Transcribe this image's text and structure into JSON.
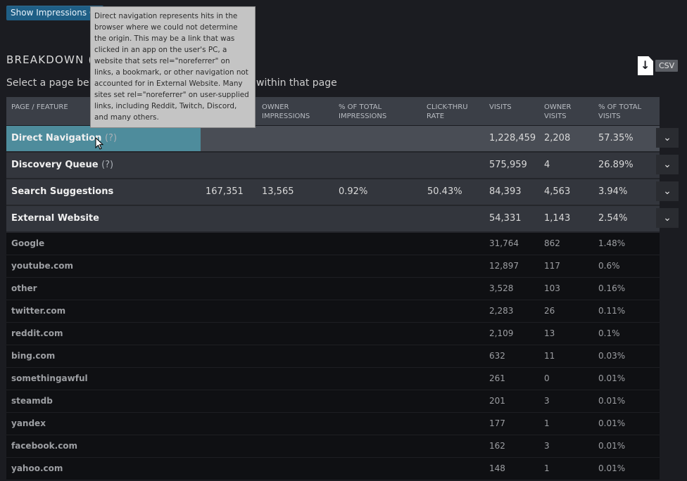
{
  "top_button": "Show Impressions Gr",
  "heading": "BREAKDOWN (",
  "subtitle_left": "Select a page belo",
  "subtitle_right": "within that page",
  "csv_label": "CSV",
  "tooltip": "Direct navigation represents hits in the browser where we could not determine the origin. This may be a link that was clicked in an app on the user's PC, a website that sets rel=\"noreferrer\" on links, a bookmark, or other navigation not accounted for in External Website. Many sites set rel=\"noreferrer\" on user-supplied links, including Reddit, Twitch, Discord, and many others.",
  "columns": {
    "page": "PAGE / FEATURE",
    "owner_impressions": "OWNER IMPRESSIONS",
    "pct_impressions": "% OF TOTAL IMPRESSIONS",
    "ctr": "CLICK-THRU RATE",
    "visits": "VISITS",
    "owner_visits": "OWNER VISITS",
    "pct_visits": "% OF TOTAL VISITS"
  },
  "rows": [
    {
      "name": "Direct Navigation",
      "help": "(?)",
      "impressions": "",
      "owner_impressions": "",
      "pct_impressions": "",
      "ctr": "",
      "visits": "1,228,459",
      "owner_visits": "2,208",
      "pct_visits": "57.35%"
    },
    {
      "name": "Discovery Queue",
      "help": "(?)",
      "impressions": "",
      "owner_impressions": "",
      "pct_impressions": "",
      "ctr": "",
      "visits": "575,959",
      "owner_visits": "4",
      "pct_visits": "26.89%"
    },
    {
      "name": "Search Suggestions",
      "help": "",
      "impressions": "167,351",
      "owner_impressions": "13,565",
      "pct_impressions": "0.92%",
      "ctr": "50.43%",
      "visits": "84,393",
      "owner_visits": "4,563",
      "pct_visits": "3.94%"
    },
    {
      "name": "External Website",
      "help": "",
      "impressions": "",
      "owner_impressions": "",
      "pct_impressions": "",
      "ctr": "",
      "visits": "54,331",
      "owner_visits": "1,143",
      "pct_visits": "2.54%"
    }
  ],
  "sub_rows": [
    {
      "name": "Google",
      "visits": "31,764",
      "owner_visits": "862",
      "pct_visits": "1.48%"
    },
    {
      "name": "youtube.com",
      "visits": "12,897",
      "owner_visits": "117",
      "pct_visits": "0.6%"
    },
    {
      "name": "other",
      "visits": "3,528",
      "owner_visits": "103",
      "pct_visits": "0.16%"
    },
    {
      "name": "twitter.com",
      "visits": "2,283",
      "owner_visits": "26",
      "pct_visits": "0.11%"
    },
    {
      "name": "reddit.com",
      "visits": "2,109",
      "owner_visits": "13",
      "pct_visits": "0.1%"
    },
    {
      "name": "bing.com",
      "visits": "632",
      "owner_visits": "11",
      "pct_visits": "0.03%"
    },
    {
      "name": "somethingawful",
      "visits": "261",
      "owner_visits": "0",
      "pct_visits": "0.01%"
    },
    {
      "name": "steamdb",
      "visits": "201",
      "owner_visits": "3",
      "pct_visits": "0.01%"
    },
    {
      "name": "yandex",
      "visits": "177",
      "owner_visits": "1",
      "pct_visits": "0.01%"
    },
    {
      "name": "facebook.com",
      "visits": "162",
      "owner_visits": "3",
      "pct_visits": "0.01%"
    },
    {
      "name": "yahoo.com",
      "visits": "148",
      "owner_visits": "1",
      "pct_visits": "0.01%"
    }
  ],
  "colors": {
    "highlight": "#4e8c9c",
    "button": "#1f5f86",
    "tooltip_bg": "#c4c4c4"
  }
}
